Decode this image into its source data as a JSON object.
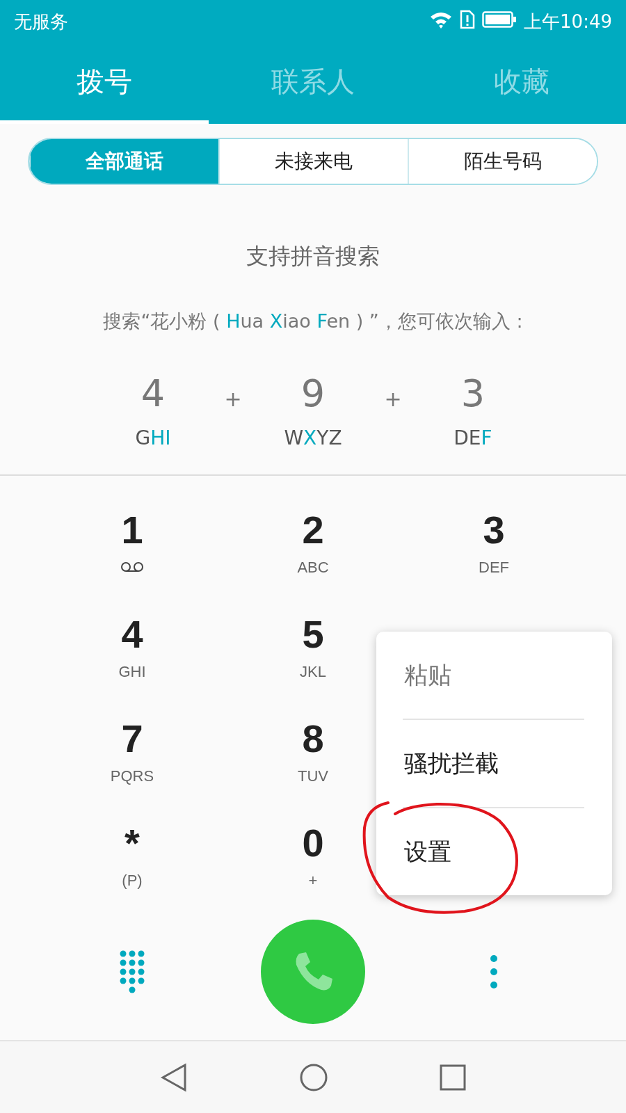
{
  "status_bar": {
    "carrier": "无服务",
    "time": "上午10:49"
  },
  "tabs": [
    {
      "label": "拨号",
      "selected": true
    },
    {
      "label": "联系人",
      "selected": false
    },
    {
      "label": "收藏",
      "selected": false
    }
  ],
  "call_filter": [
    {
      "label": "全部通话",
      "selected": true
    },
    {
      "label": "未接来电",
      "selected": false
    },
    {
      "label": "陌生号码",
      "selected": false
    }
  ],
  "pinyin_hint": {
    "title": "支持拼音搜索",
    "sentence": "搜索“花小粉 ( **H**ua **X**iao **F**en ) ”，您可依次输入 :",
    "keys": [
      {
        "digit": "4",
        "letters": "G**HI**"
      },
      {
        "digit": "9",
        "letters": "W**X**YZ"
      },
      {
        "digit": "3",
        "letters": "DE**F**"
      }
    ],
    "joiners": [
      "+",
      "+"
    ]
  },
  "dial_pad": [
    {
      "digit": "1",
      "kind": "voicemail"
    },
    {
      "digit": "2",
      "letters": "ABC",
      "kind": "letters"
    },
    {
      "digit": "3",
      "letters": "DEF",
      "kind": "letters"
    },
    {
      "digit": "4",
      "letters": "GHI",
      "kind": "letters"
    },
    {
      "digit": "5",
      "letters": "JKL",
      "kind": "letters"
    },
    {
      "kind": "hidden"
    },
    {
      "digit": "7",
      "letters": "PQRS",
      "kind": "letters"
    },
    {
      "digit": "8",
      "letters": "TUV",
      "kind": "letters"
    },
    {
      "kind": "hidden"
    },
    {
      "digit": "*",
      "letters": "(P)",
      "kind": "letters"
    },
    {
      "digit": "0",
      "letters": "+",
      "kind": "letters"
    },
    {
      "kind": "hidden"
    }
  ],
  "menu": [
    {
      "label": "粘贴",
      "disabled": true
    },
    {
      "label": "骚扰拦截",
      "disabled": false
    },
    {
      "label": "设置",
      "disabled": false
    }
  ]
}
